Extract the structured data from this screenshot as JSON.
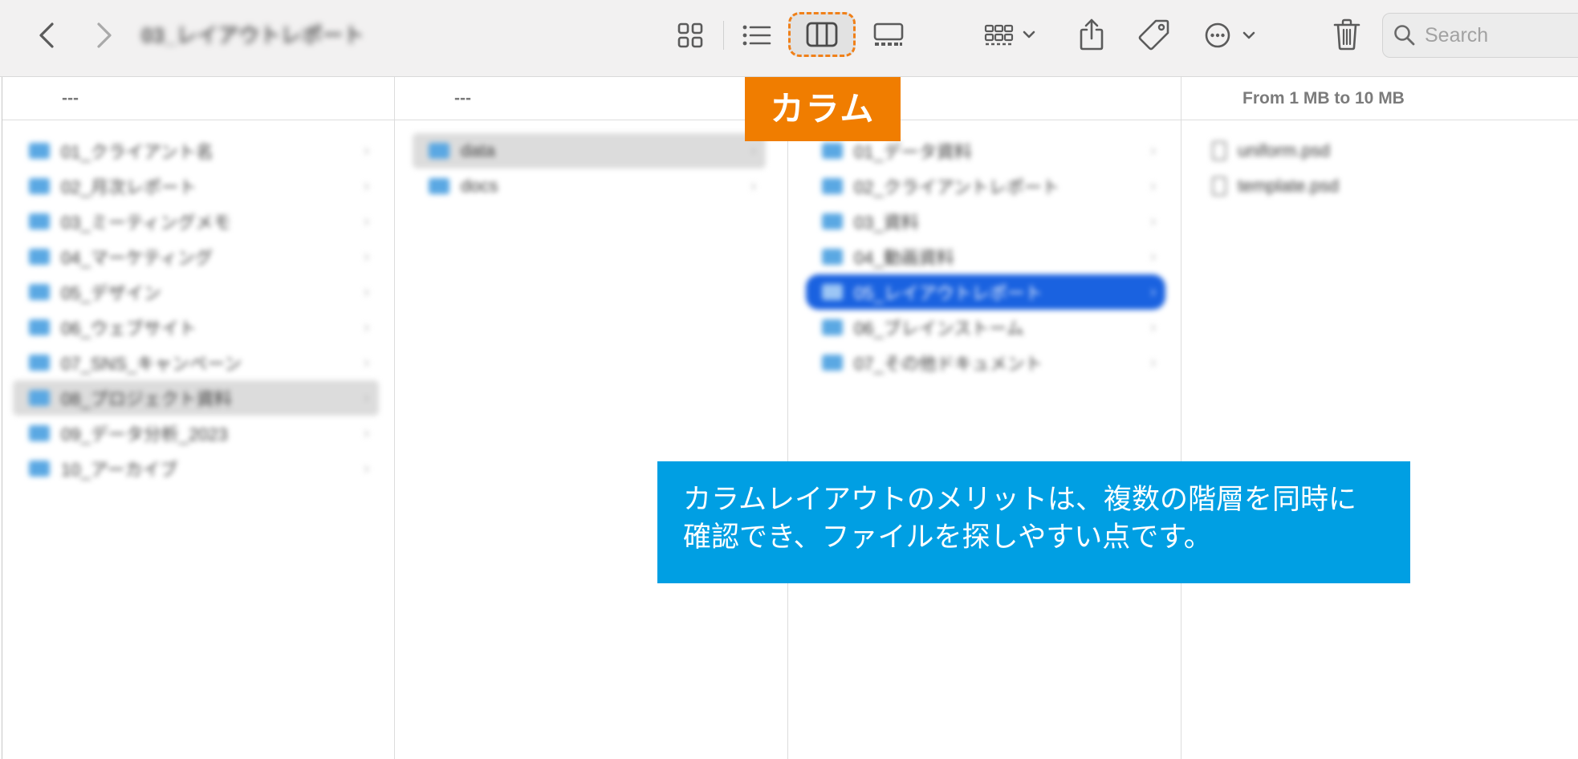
{
  "toolbar": {
    "window_title": "03_レイアウトレポート",
    "icons": {
      "back": "chevron-left-icon",
      "forward": "chevron-right-icon",
      "view_icons": "icon-grid-icon",
      "view_list": "list-icon",
      "view_column": "columns-icon",
      "view_gallery": "gallery-icon",
      "group": "group-by-icon",
      "share": "share-icon",
      "tag": "tag-icon",
      "more": "ellipsis-circle-icon",
      "trash": "trash-icon",
      "search": "search-icon"
    },
    "search": {
      "placeholder": "Search",
      "value": ""
    },
    "selected_view_label": "カラム"
  },
  "columns": [
    {
      "header": "---",
      "rows": [
        {
          "label": "01_クライアント名",
          "chevron": "›"
        },
        {
          "label": "02_月次レポート",
          "chevron": "›"
        },
        {
          "label": "03_ミーティングメモ",
          "chevron": "›"
        },
        {
          "label": "04_マーケティング",
          "chevron": "›"
        },
        {
          "label": "05_デザイン",
          "chevron": "›"
        },
        {
          "label": "06_ウェブサイト",
          "chevron": "›"
        },
        {
          "label": "07_SNS_キャンペーン",
          "chevron": "›"
        },
        {
          "label": "08_プロジェクト資料",
          "chevron": "›",
          "selected": "gray"
        },
        {
          "label": "09_データ分析_2023",
          "chevron": "›"
        },
        {
          "label": "10_アーカイブ",
          "chevron": "›"
        }
      ]
    },
    {
      "header": "---",
      "rows": [
        {
          "label": "data",
          "chevron": "›",
          "selected": "gray"
        },
        {
          "label": "docs",
          "chevron": "›"
        }
      ]
    },
    {
      "header": "",
      "rows": [
        {
          "label": "01_データ資料",
          "chevron": "›"
        },
        {
          "label": "02_クライアントレポート",
          "chevron": "›"
        },
        {
          "label": "03_資料",
          "chevron": "›"
        },
        {
          "label": "04_動画資料",
          "chevron": "›"
        },
        {
          "label": "05_レイアウトレポート",
          "chevron": "›",
          "selected": "blue"
        },
        {
          "label": "06_ブレインストーム",
          "chevron": "›"
        },
        {
          "label": "07_その他ドキュメント",
          "chevron": "›"
        }
      ]
    },
    {
      "header": "From 1 MB to 10 MB",
      "files": [
        {
          "label": "uniform.psd"
        },
        {
          "label": "template.psd"
        }
      ]
    }
  ],
  "callout": {
    "line1": "カラムレイアウトのメリットは、複数の階層を同時に",
    "line2": "確認でき、ファイルを探しやすい点です。"
  },
  "colors": {
    "accent_orange": "#f07d00",
    "callout_blue": "#009fe3",
    "selection_blue": "#1a62e0"
  }
}
